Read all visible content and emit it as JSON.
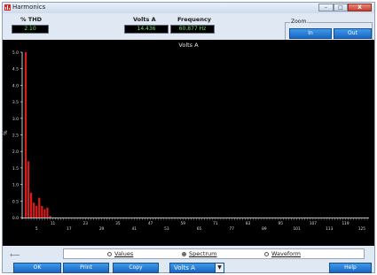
{
  "window": {
    "title": "Harmonics",
    "controls": {
      "minimize": "–",
      "maximize": "□",
      "close": "X"
    }
  },
  "readouts": {
    "thd_label": "% THD",
    "thd_value": "2.10",
    "channel_label": "Volts A",
    "channel_value": "14.436",
    "frequency_label": "Frequency",
    "frequency_value": "60.877 Hz"
  },
  "zoom": {
    "legend": "Zoom",
    "in_label": "In",
    "out_label": "Out"
  },
  "view_mode": {
    "options": [
      "Values",
      "Spectrum",
      "Waveform"
    ],
    "selected": "Spectrum"
  },
  "footer": {
    "ok_label": "OK",
    "print_label": "Print",
    "copy_label": "Copy",
    "channel_select_value": "Volts A",
    "help_label": "Help"
  },
  "colors": {
    "bar": "#d81c1c",
    "plot_background": "#000000",
    "axis": "#ffffff",
    "button": "#1f73d1",
    "readout_text": "#78e070"
  },
  "chart_data": {
    "type": "bar",
    "title": "Volts A",
    "ylabel": "%",
    "ylim": [
      0,
      5.0
    ],
    "yticks": [
      "0.0",
      "0.5",
      "1.0",
      "1.5",
      "2.0",
      "2.5",
      "3.0",
      "3.5",
      "4.0",
      "4.5",
      "5.0"
    ],
    "xticks": [
      "5",
      "11",
      "17",
      "23",
      "29",
      "35",
      "41",
      "47",
      "53",
      "59",
      "65",
      "71",
      "77",
      "83",
      "89",
      "95",
      "101",
      "107",
      "113",
      "119",
      "125"
    ],
    "xtick_interval": 6,
    "categories": [
      1,
      2,
      3,
      4,
      5,
      6,
      7,
      8,
      9,
      10
    ],
    "values": [
      5.0,
      1.7,
      0.75,
      0.45,
      0.35,
      0.6,
      0.35,
      0.25,
      0.3,
      0.05
    ]
  }
}
